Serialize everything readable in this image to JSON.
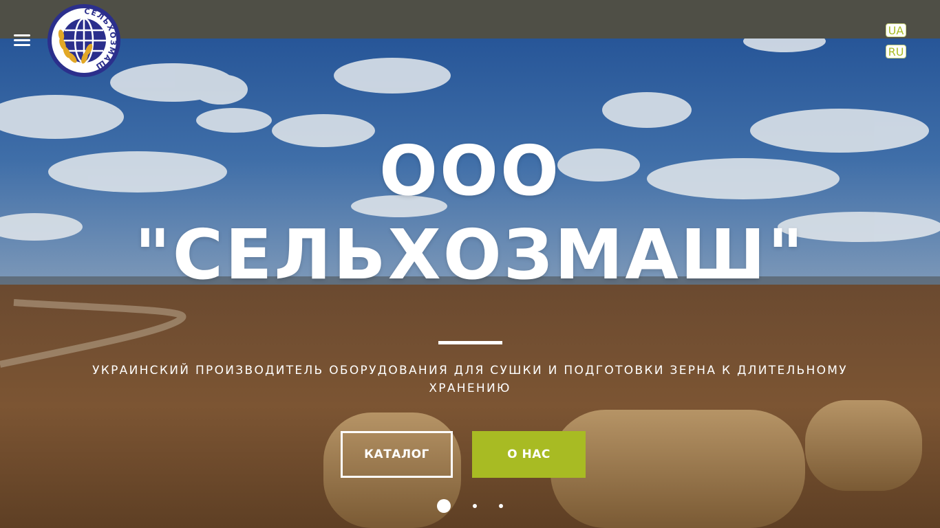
{
  "brand": {
    "logo_icon": "globe-wheat-logo",
    "logo_text": "СЕЛЬХОЗМАШ",
    "accent_color": "#a8bb23",
    "topbar_color": "#4f4f46"
  },
  "header": {
    "menu_icon": "hamburger-menu-icon",
    "languages": [
      "UA",
      "RU"
    ]
  },
  "hero": {
    "title_line1": "ООО",
    "title_line2": "\"СЕЛЬХОЗМАШ\"",
    "subtitle": "УКРАИНСКИЙ ПРОИЗВОДИТЕЛЬ ОБОРУДОВАНИЯ ДЛЯ СУШКИ И ПОДГОТОВКИ ЗЕРНА К ДЛИТЕЛЬНОМУ ХРАНЕНИЮ",
    "background": "sky with clouds over a harvested wheat field with round hay bales",
    "buttons": {
      "catalog": "КАТАЛОГ",
      "about": "О НАС"
    }
  },
  "slider": {
    "slide_count": 3,
    "active_index": 0
  }
}
